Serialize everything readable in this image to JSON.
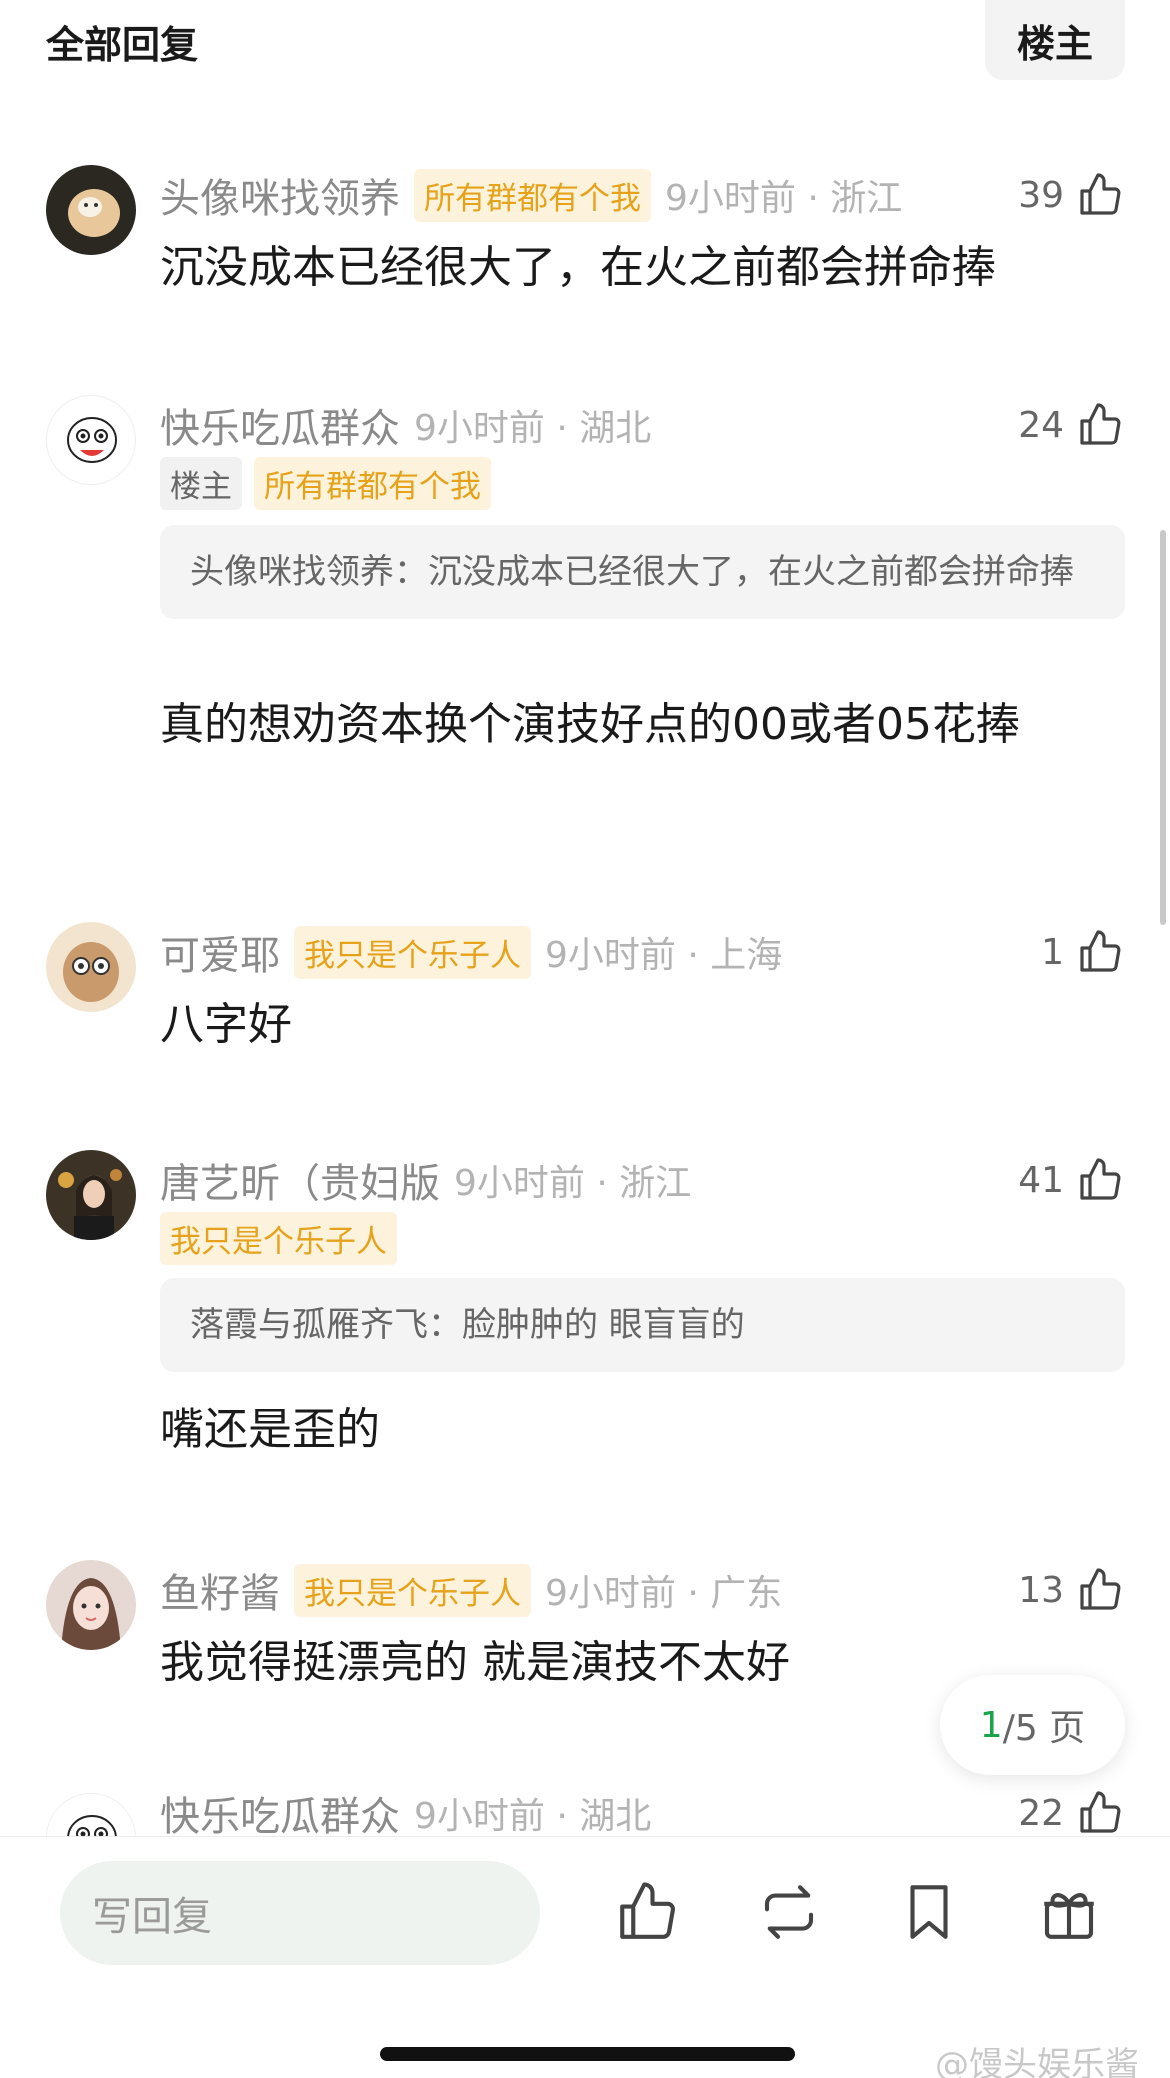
{
  "header": {
    "title": "全部回复",
    "op_filter_label": "楼主"
  },
  "comments": [
    {
      "username": "头像咪找领养",
      "badge": "所有群都有个我",
      "meta": "9小时前 · 浙江",
      "likes": "39",
      "text": "沉没成本已经很大了，在火之前都会拼命捧"
    },
    {
      "username": "快乐吃瓜群众",
      "meta": "9小时前 · 湖北",
      "likes": "24",
      "op_badge": "楼主",
      "badge": "所有群都有个我",
      "quote": "头像咪找领养：沉没成本已经很大了，在火之前都会拼命捧",
      "text": "真的想劝资本换个演技好点的00或者05花捧"
    },
    {
      "username": "可爱耶",
      "badge": "我只是个乐子人",
      "meta": "9小时前 · 上海",
      "likes": "1",
      "text": "八字好"
    },
    {
      "username": "唐艺昕（贵妇版",
      "meta": "9小时前 · 浙江",
      "likes": "41",
      "badge": "我只是个乐子人",
      "quote": "落霞与孤雁齐飞：脸肿肿的 眼盲盲的",
      "text": "嘴还是歪的"
    },
    {
      "username": "鱼籽酱",
      "badge": "我只是个乐子人",
      "meta": "9小时前 · 广东",
      "likes": "13",
      "text": "我觉得挺漂亮的 就是演技不太好"
    },
    {
      "username": "快乐吃瓜群众",
      "meta": "9小时前 · 湖北",
      "likes": "22"
    }
  ],
  "pager": {
    "current": "1",
    "total": "/5 页"
  },
  "bottom_bar": {
    "reply_placeholder": "写回复",
    "icons": [
      "thumbs-up-icon",
      "repost-icon",
      "bookmark-icon",
      "gift-icon"
    ]
  },
  "watermark": "@馒头娱乐酱",
  "colors": {
    "badge_gold": "#e6a21a",
    "badge_gold_bg": "#fdf3dc",
    "pager_current": "#1aa34a"
  }
}
